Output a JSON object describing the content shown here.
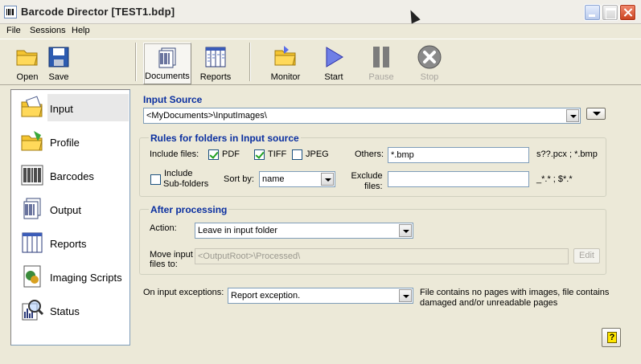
{
  "window": {
    "title": "Barcode Director  [TEST1.bdp]"
  },
  "menu": [
    "File",
    "Sessions",
    "Help"
  ],
  "toolbar": {
    "open": "Open",
    "save": "Save",
    "documents": "Documents",
    "reports": "Reports",
    "monitor": "Monitor",
    "start": "Start",
    "pause": "Pause",
    "stop": "Stop"
  },
  "nav": [
    {
      "label": "Input",
      "selected": true
    },
    {
      "label": "Profile"
    },
    {
      "label": "Barcodes"
    },
    {
      "label": "Output"
    },
    {
      "label": "Reports"
    },
    {
      "label": "Imaging Scripts"
    },
    {
      "label": "Status"
    }
  ],
  "input_source": {
    "title": "Input Source",
    "value": "<MyDocuments>\\InputImages\\"
  },
  "rules": {
    "title": "Rules for folders in Input source",
    "include_files_label": "Include files:",
    "pdf": "PDF",
    "tiff": "TIFF",
    "jpeg": "JPEG",
    "others_label": "Others:",
    "others_value": "*.bmp",
    "others_hint": "s??.pcx ; *.bmp",
    "include_subfolders_line1": "Include",
    "include_subfolders_line2": "Sub-folders",
    "sort_by_label": "Sort by:",
    "sort_by_value": "name",
    "exclude_line1": "Exclude",
    "exclude_line2": "files:",
    "exclude_value": "",
    "exclude_hint": "_*.* ; $*.*"
  },
  "after": {
    "title": "After processing",
    "action_label": "Action:",
    "action_value": "Leave in input folder",
    "move_line1": "Move input",
    "move_line2": "files to:",
    "move_value": "<OutputRoot>\\Processed\\",
    "edit_label": "Edit"
  },
  "exceptions": {
    "label": "On input exceptions:",
    "value": "Report exception.",
    "note_line1": "File contains no pages with images, file contains",
    "note_line2": "damaged and/or unreadable pages"
  },
  "help_icon": "help-icon"
}
